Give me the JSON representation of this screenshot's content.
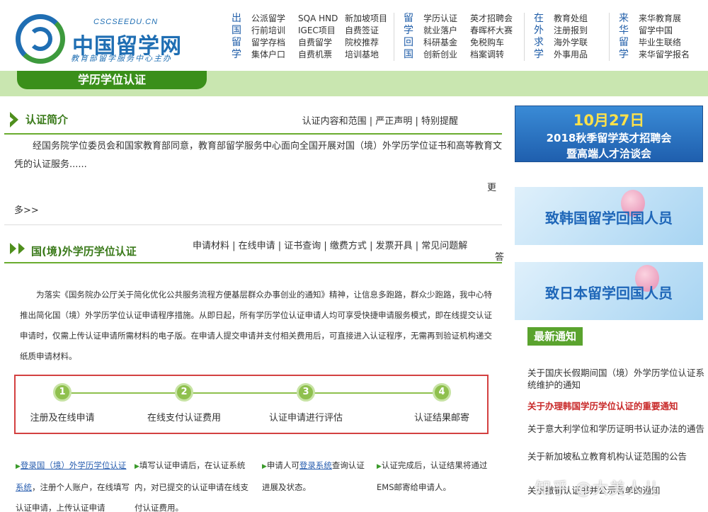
{
  "header": {
    "logo_en": "CSCSEEDU.CN",
    "logo_cn": "中国留学网",
    "logo_sub": "教育部留学服务中心主办",
    "nav": [
      {
        "head": "出国留学",
        "cols": [
          [
            "公派留学",
            "行前培训",
            "留学存档",
            "集体户口"
          ],
          [
            "SQA HND",
            "IGEC项目",
            "自费留学",
            "自费机票"
          ],
          [
            "新加坡项目",
            "自费签证",
            "院校推荐",
            "培训基地"
          ]
        ]
      },
      {
        "head": "留学回国",
        "cols": [
          [
            "学历认证",
            "就业落户",
            "科研基金",
            "创新创业"
          ],
          [
            "英才招聘会",
            "春晖杯大赛",
            "免税购车",
            "档案调转"
          ]
        ]
      },
      {
        "head": "在外求学",
        "cols": [
          [
            "教育处组",
            "注册报到",
            "海外学联",
            "外事用品"
          ]
        ]
      },
      {
        "head": "来华留学",
        "cols": [
          [
            "来华教育展",
            "留学中国",
            "毕业生联络",
            "来华留学报名"
          ]
        ]
      }
    ],
    "page_title": "学历学位认证"
  },
  "intro": {
    "title": "认证简介",
    "links": [
      "认证内容和范围",
      "严正声明",
      "特别提醒"
    ],
    "text": "经国务院学位委员会和国家教育部同意，教育部留学服务中心面向全国开展对国（境）外学历学位证书和高等教育文凭的认证服务......",
    "more_a": "更",
    "more_b": "多>>"
  },
  "foreign": {
    "title": "国(境)外学历学位认证",
    "links_line1": "申请材料 |  在线申请  |  证书查询  |  缴费方式  |  发票开具  |  常见问题解",
    "links_line2": "答",
    "text": "为落实《国务院办公厅关于简化优化公共服务流程方便基层群众办事创业的通知》精神，让信息多跑路，群众少跑路，我中心特推出简化国（境）外学历学位认证申请程序措施。从即日起，所有学历学位认证申请人均可享受快捷申请服务模式，即在线提交认证申请时，仅需上传认证申请所需材料的电子版。在申请人提交申请并支付相关费用后，可直接进入认证程序，无需再到验证机构递交纸质申请材料。",
    "steps": [
      {
        "num": "1",
        "label": "注册及在线申请"
      },
      {
        "num": "2",
        "label": "在线支付认证费用"
      },
      {
        "num": "3",
        "label": "认证申请进行评估"
      },
      {
        "num": "4",
        "label": "认证结果邮寄"
      }
    ],
    "instructions": [
      {
        "link": "登录国（境）外学历学位认证系统",
        "rest": "，注册个人账户，在线填写认证申请，上传认证申请"
      },
      {
        "link": "",
        "rest": "填写认证申请后，在认证系统内，对已提交的认证申请在线支付认证费用。"
      },
      {
        "pre": "申请人可",
        "link": "登录系统",
        "rest": "查询认证进展及状态。"
      },
      {
        "link": "",
        "rest": "认证完成后，认证结果将通过EMS邮寄给申请人。"
      }
    ]
  },
  "sidebar": {
    "ad1_line1": "10月27日",
    "ad1_line2": "2018秋季留学英才招聘会",
    "ad1_line3": "暨高端人才洽谈会",
    "ad2": "致韩国留学回国人员",
    "ad3": "致日本留学回国人员",
    "news_title": "最新通知",
    "news": [
      "关于国庆长假期间国（境）外学历学位认证系统维护的通知",
      "关于办理韩国学历学位认证的重要通知",
      "关于意大利学位和学历证明书认证办法的通告",
      "关于新加坡私立教育机构认证范围的公告",
      "关于撤销认证书并公示名单的通知"
    ],
    "watermark": "知乎 @大美人儿"
  },
  "colors": {
    "brand_blue": "#1f6eb3",
    "brand_green": "#3a8f1a",
    "highlight_red": "#c82828"
  }
}
